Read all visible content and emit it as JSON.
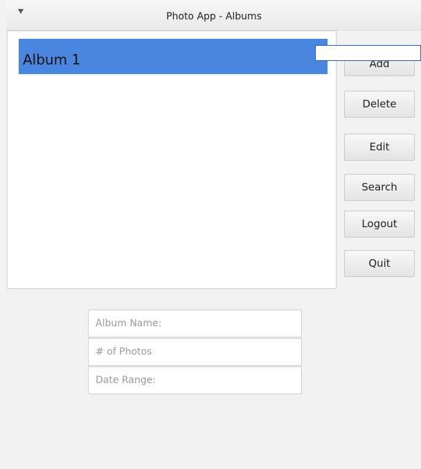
{
  "window": {
    "title": "Photo App - Albums",
    "menu_icon": "chevron-down-icon"
  },
  "albums": {
    "items": [
      {
        "label": "Album 1",
        "selected": true
      }
    ],
    "selected_color": "#4a86e0"
  },
  "buttons": {
    "add": "Add",
    "delete": "Delete",
    "edit": "Edit",
    "search": "Search",
    "logout": "Logout",
    "quit": "Quit"
  },
  "fields": {
    "album_name": {
      "value": "",
      "placeholder": "Album Name:"
    },
    "num_photos": {
      "value": "",
      "placeholder": "# of Photos"
    },
    "date_range": {
      "value": "",
      "placeholder": "Date Range:"
    }
  },
  "inline_editor": {
    "value": "",
    "border_color": "#1f55d8"
  }
}
